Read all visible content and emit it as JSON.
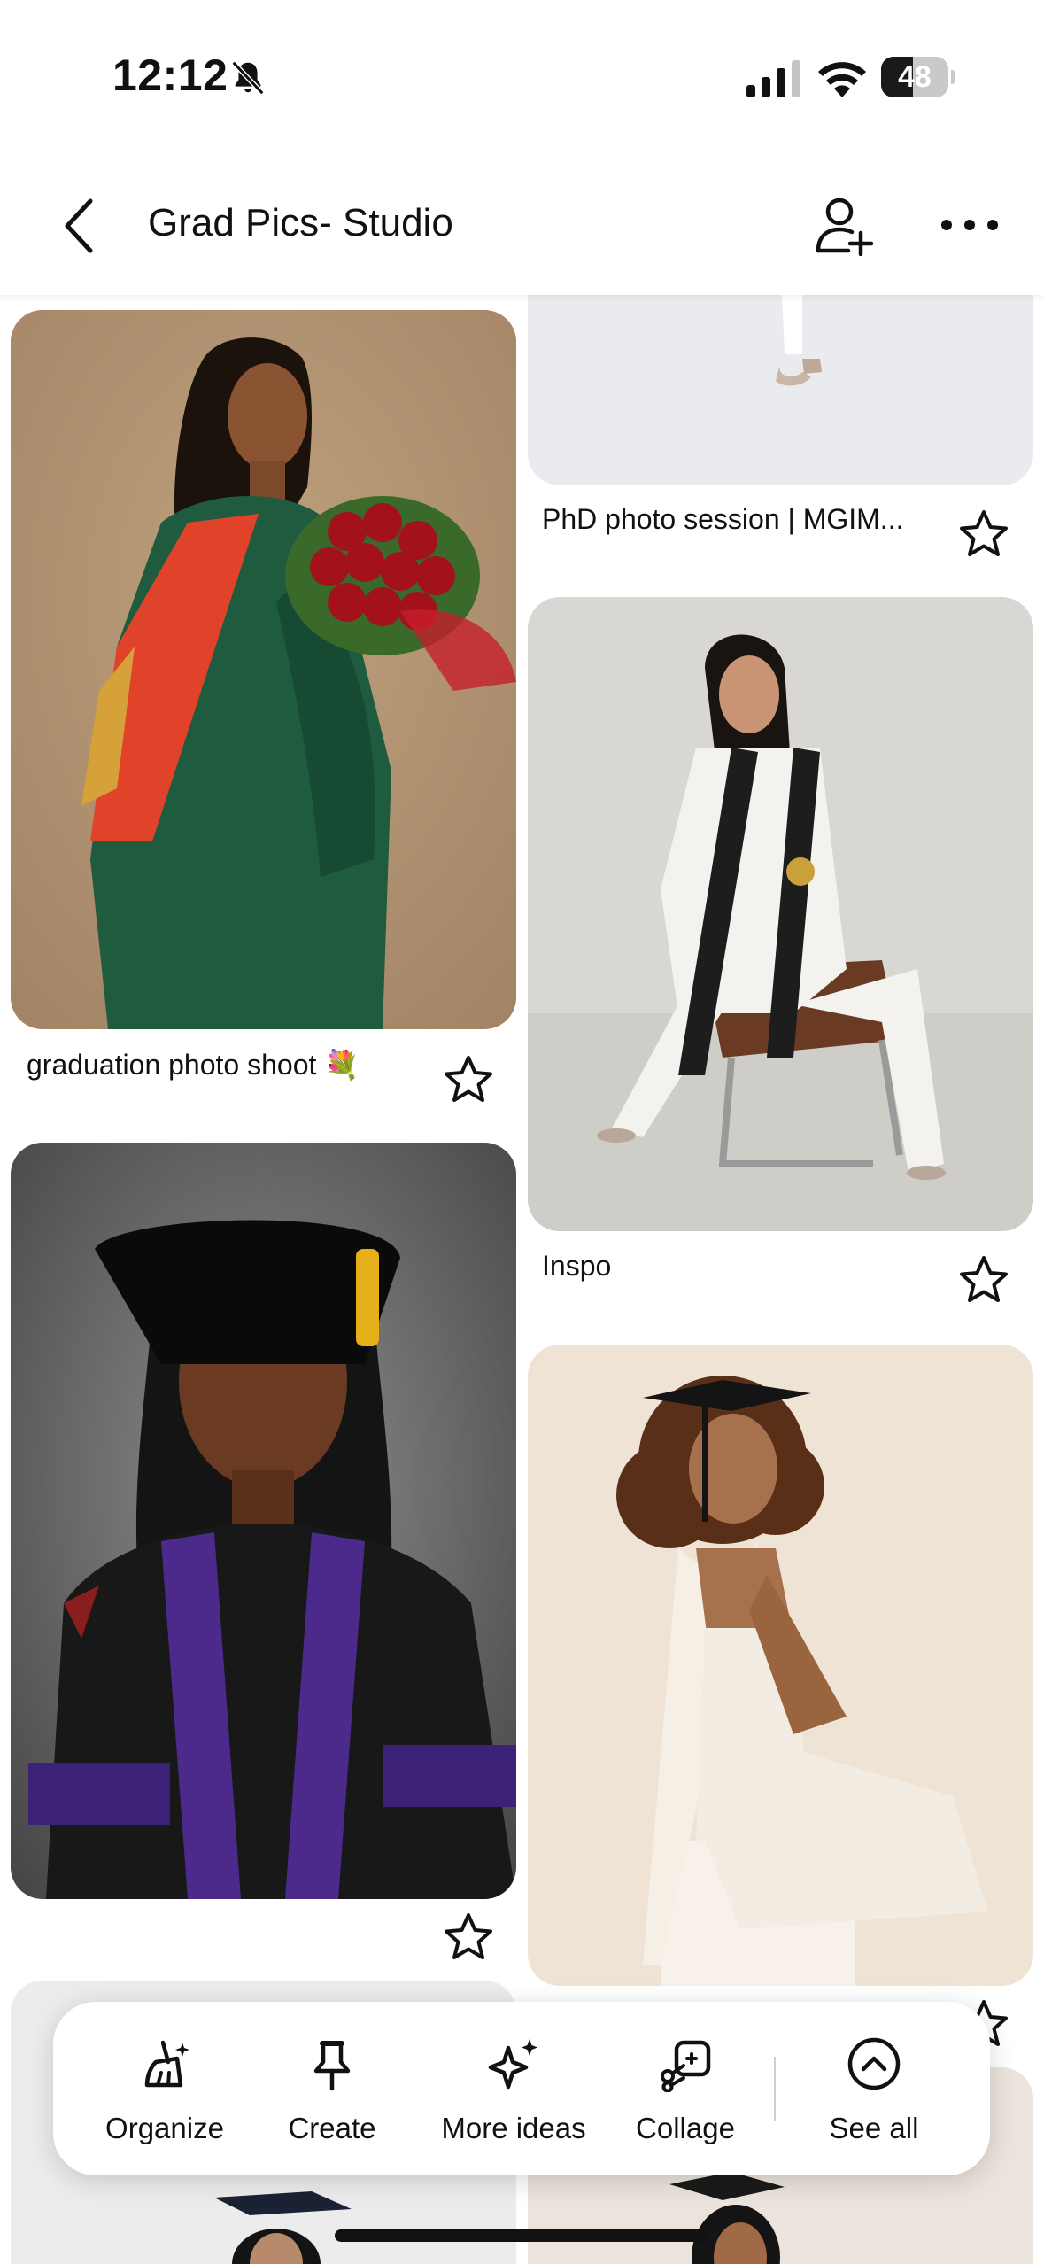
{
  "status_bar": {
    "time": "12:12",
    "battery_percent": "48",
    "battery_level": 0.48,
    "icons": [
      "bell-slash-icon",
      "cellular-signal-icon",
      "wifi-icon",
      "battery-icon"
    ]
  },
  "header": {
    "title": "Grad Pics- Studio",
    "icons": [
      "chevron-left-icon",
      "add-collaborator-icon",
      "more-horizontal-icon"
    ]
  },
  "pins": [
    {
      "title": "graduation photo shoot 💐",
      "subject": "green graduation gown with red roses"
    },
    {
      "title": "",
      "subject": "doctoral regalia with velvet tam"
    },
    {
      "title": "PhD photo session | MGIM...",
      "subject": "white outfit partial view"
    },
    {
      "title": "Inspo",
      "subject": "white suit with black stole on chair"
    },
    {
      "title": "",
      "subject": "curly hair with graduation cap and white dress"
    }
  ],
  "action_bar": {
    "items": [
      {
        "label": "Organize",
        "icon": "broom-sparkle-icon"
      },
      {
        "label": "Create",
        "icon": "pin-icon"
      },
      {
        "label": "More ideas",
        "icon": "sparkles-icon"
      },
      {
        "label": "Collage",
        "icon": "collage-scissors-icon"
      },
      {
        "label": "See all",
        "icon": "chevron-up-circle-icon"
      }
    ]
  },
  "colors": {
    "background": "#ffffff",
    "text": "#111111",
    "divider": "#cfcfcf"
  }
}
